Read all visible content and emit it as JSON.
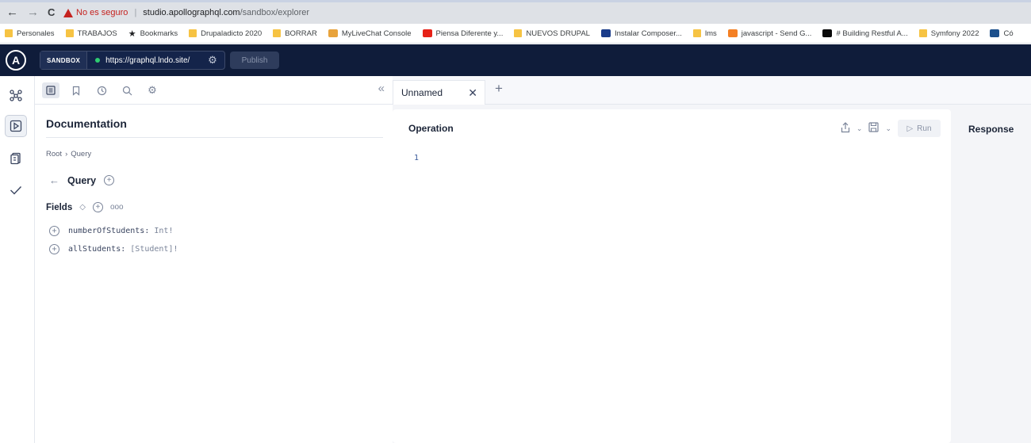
{
  "browser": {
    "back_glyph": "←",
    "forward_glyph": "→",
    "reload_glyph": "C",
    "security_warning": "No es seguro",
    "url_host": "studio.apollographql.com",
    "url_path": "/sandbox/explorer"
  },
  "bookmarks": [
    {
      "label": "Personales",
      "icon": "folder-icon"
    },
    {
      "label": "TRABAJOS",
      "icon": "folder-icon"
    },
    {
      "label": "Bookmarks",
      "icon": "star-icon"
    },
    {
      "label": "Drupaladicto 2020",
      "icon": "folder-icon"
    },
    {
      "label": "BORRAR",
      "icon": "folder-icon"
    },
    {
      "label": "MyLiveChat Console",
      "icon": "chat-icon"
    },
    {
      "label": "Piensa Diferente y...",
      "icon": "youtube-icon"
    },
    {
      "label": "NUEVOS DRUPAL",
      "icon": "folder-icon"
    },
    {
      "label": "Instalar Composer...",
      "icon": "vimeo-icon"
    },
    {
      "label": "lms",
      "icon": "folder-icon"
    },
    {
      "label": "javascript - Send G...",
      "icon": "stackoverflow-icon"
    },
    {
      "label": "# Building Restful A...",
      "icon": "dev-icon"
    },
    {
      "label": "Symfony 2022",
      "icon": "folder-icon"
    },
    {
      "label": "Có",
      "icon": "lh-icon"
    }
  ],
  "topbar": {
    "logo_letter": "A",
    "sandbox_tag": "SANDBOX",
    "endpoint_url": "https://graphql.lndo.site/",
    "publish_label": "Publish",
    "status_color": "#2ecc71"
  },
  "docs": {
    "title": "Documentation",
    "breadcrumb": [
      "Root",
      "Query"
    ],
    "breadcrumb_sep": "›",
    "type_name": "Query",
    "fields_label": "Fields",
    "fields": [
      {
        "name": "numberOfStudents:",
        "type": "Int!"
      },
      {
        "name": "allStudents:",
        "type": "[Student]!"
      }
    ]
  },
  "tabs": {
    "active_tab": "Unnamed",
    "add_glyph": "+"
  },
  "operation": {
    "title": "Operation",
    "run_label": "Run",
    "line_number": "1"
  },
  "response": {
    "title": "Response"
  }
}
